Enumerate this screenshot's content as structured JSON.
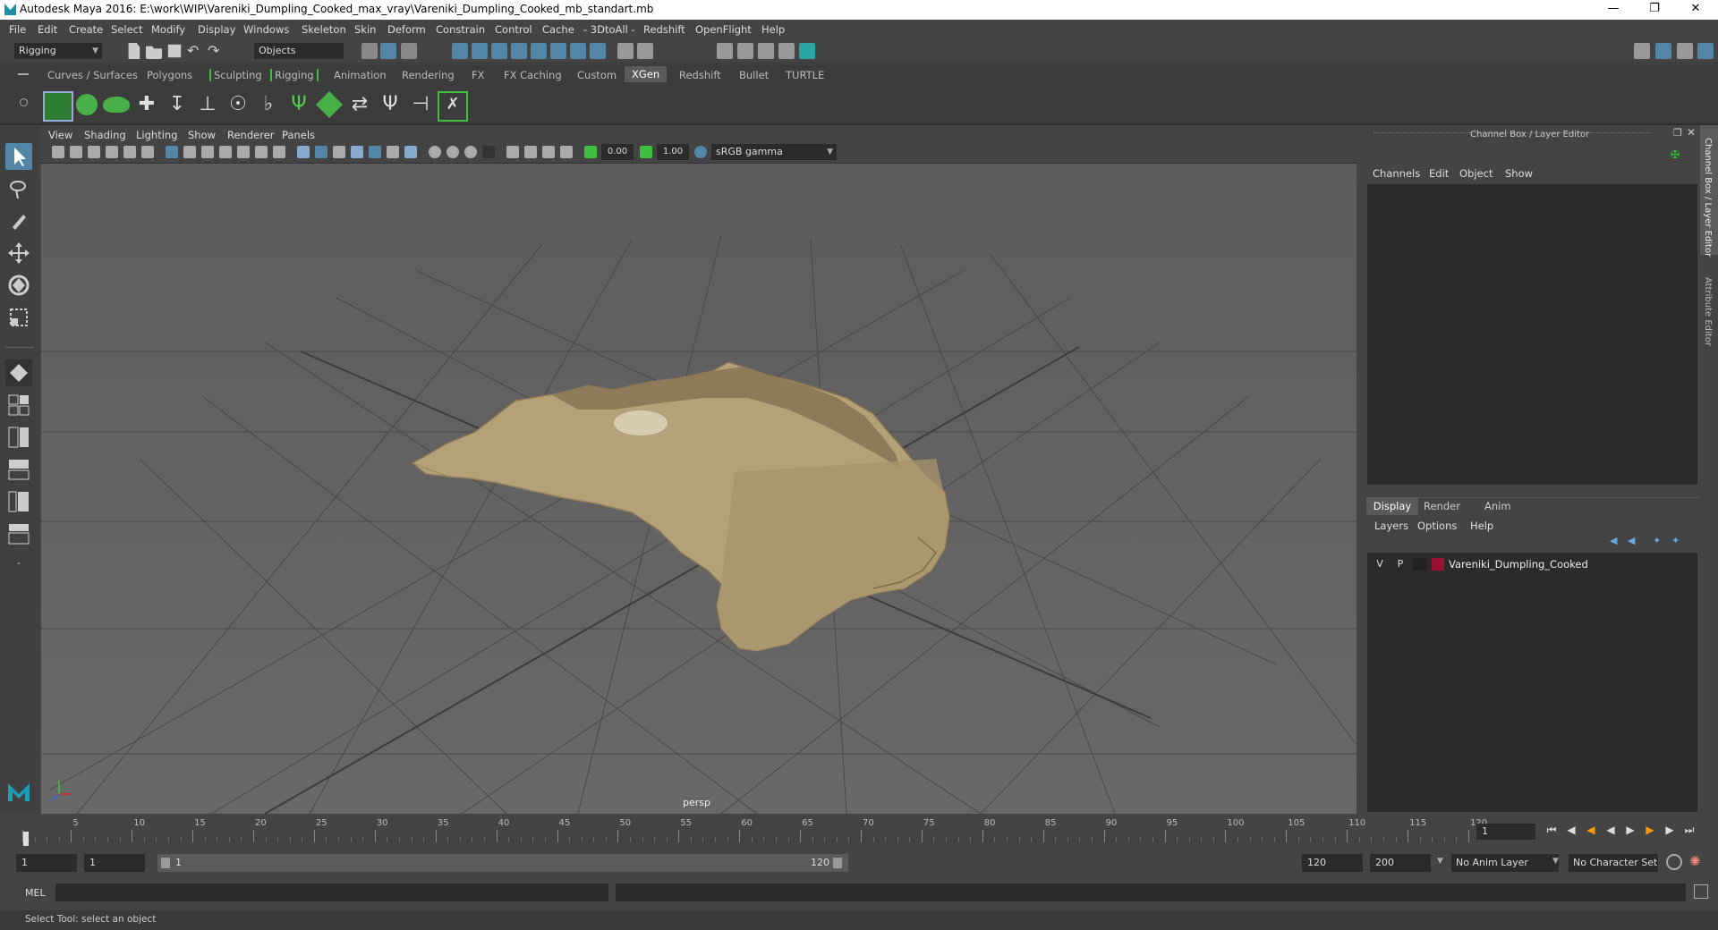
{
  "window": {
    "title": "Autodesk Maya 2016: E:\\work\\WIP\\Vareniki_Dumpling_Cooked_max_vray\\Vareniki_Dumpling_Cooked_mb_standart.mb"
  },
  "menubar": {
    "items": [
      "File",
      "Edit",
      "Create",
      "Select",
      "Modify",
      "Display",
      "Windows",
      "Skeleton",
      "Skin",
      "Deform",
      "Constrain",
      "Control",
      "Cache",
      "- 3DtoAll -",
      "Redshift",
      "OpenFlight",
      "Help"
    ]
  },
  "toolbar": {
    "mode": "Rigging",
    "selection_mask": "Objects"
  },
  "shelf": {
    "tabs": [
      "Curves / Surfaces",
      "Polygons",
      "Sculpting",
      "Rigging",
      "Animation",
      "Rendering",
      "FX",
      "FX Caching",
      "Custom",
      "XGen",
      "Redshift",
      "Bullet",
      "TURTLE"
    ],
    "active": "XGen"
  },
  "panel": {
    "menus": [
      "View",
      "Shading",
      "Lighting",
      "Show",
      "Renderer",
      "Panels"
    ],
    "exposure": "0.00",
    "gamma": "1.00",
    "color_space": "sRGB gamma",
    "camera_label": "persp"
  },
  "channel_box": {
    "title": "Channel Box / Layer Editor",
    "menus": [
      "Channels",
      "Edit",
      "Object",
      "Show"
    ]
  },
  "layer_editor": {
    "tabs": [
      "Display",
      "Render",
      "Anim"
    ],
    "active_tab": "Display",
    "menus": [
      "Layers",
      "Options",
      "Help"
    ],
    "layers": [
      {
        "v": "V",
        "p": "P",
        "name": "Vareniki_Dumpling_Cooked",
        "color": "#9b1030"
      }
    ]
  },
  "side_tabs": {
    "channel_box": "Channel Box / Layer Editor",
    "attribute_editor": "Attribute Editor"
  },
  "timeline": {
    "ticks": [
      "1",
      "5",
      "10",
      "15",
      "20",
      "25",
      "30",
      "35",
      "40",
      "45",
      "50",
      "55",
      "60",
      "65",
      "70",
      "75",
      "80",
      "85",
      "90",
      "95",
      "100",
      "105",
      "110",
      "115",
      "120"
    ],
    "current_frame": "1"
  },
  "range": {
    "start": "1",
    "playback_start": "1",
    "slider_start": "1",
    "slider_end": "120",
    "playback_end": "120",
    "end": "200",
    "anim_layer": "No Anim Layer",
    "character_set": "No Character Set"
  },
  "cmdline": {
    "label": "MEL"
  },
  "helpline": {
    "text": "Select Tool: select an object"
  },
  "colors": {
    "accent": "#5285a6",
    "shelf_green": "#3fbf3f",
    "layer_color": "#9b1030"
  }
}
